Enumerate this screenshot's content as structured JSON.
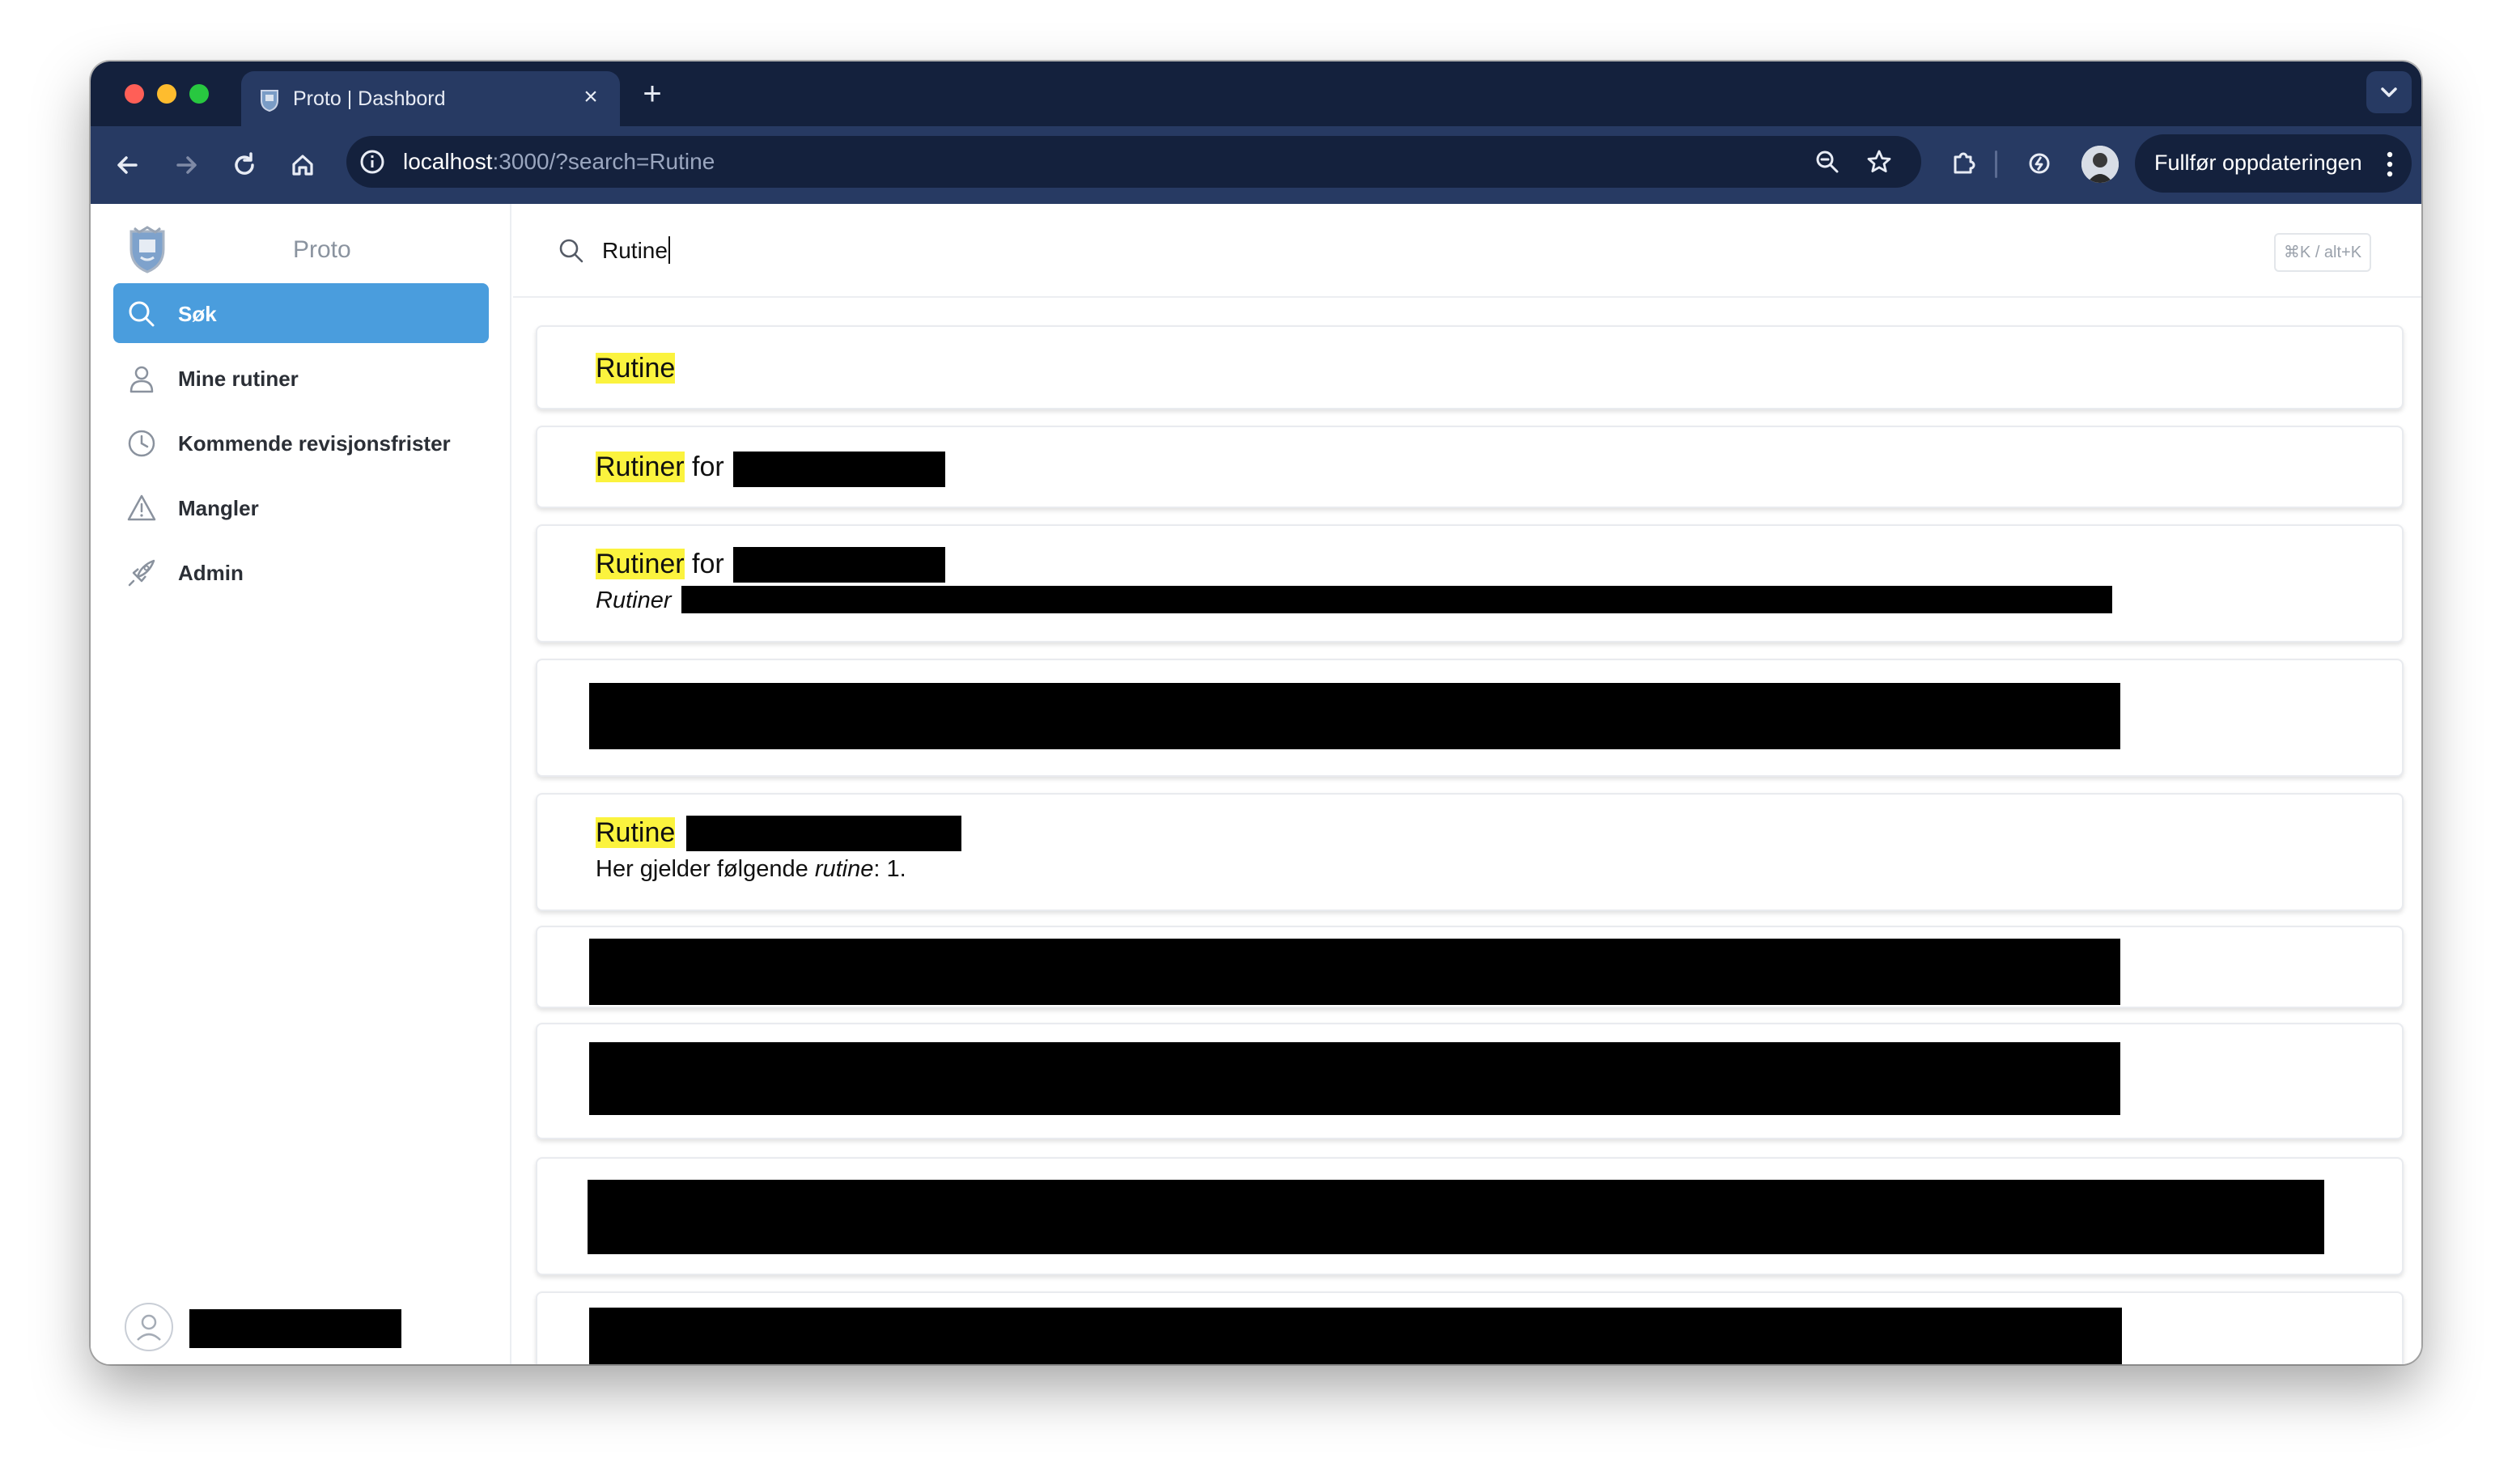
{
  "browser": {
    "tab_title": "Proto | Dashbord",
    "url_host": "localhost",
    "url_rest": ":3000/?search=Rutine",
    "update_button": "Fullfør oppdateringen"
  },
  "sidebar": {
    "app_name": "Proto",
    "items": [
      {
        "label": "Søk",
        "icon": "search-icon",
        "active": true
      },
      {
        "label": "Mine rutiner",
        "icon": "user-icon",
        "active": false
      },
      {
        "label": "Kommende revisjonsfrister",
        "icon": "clock-icon",
        "active": false
      },
      {
        "label": "Mangler",
        "icon": "warning-icon",
        "active": false
      },
      {
        "label": "Admin",
        "icon": "rocket-icon",
        "active": false
      }
    ]
  },
  "search": {
    "query": "Rutine",
    "shortcut": "⌘K / alt+K"
  },
  "results": [
    {
      "highlight": "Rutine",
      "title_rest": ""
    },
    {
      "highlight": "Rutiner",
      "title_rest": " for "
    },
    {
      "highlight": "Rutiner",
      "title_rest": " for ",
      "snippet_italic": "Rutiner"
    },
    {
      "highlight": "Rutine",
      "title_rest": "",
      "snippet_pre": "Her gjelder følgende ",
      "snippet_italic": "rutine",
      "snippet_post": ": 1."
    }
  ]
}
